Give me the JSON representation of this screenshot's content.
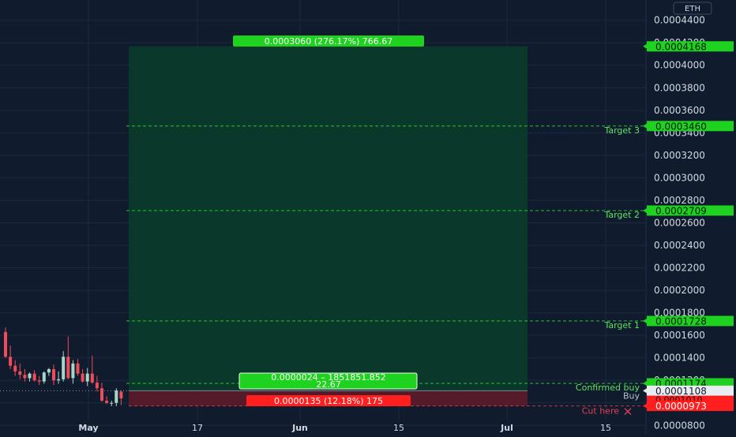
{
  "currency": "ETH",
  "colors": {
    "background": "#101b2e",
    "grid": "#1b2a40",
    "up": "#a5d6c8",
    "down": "#ef4b59",
    "profit_zone": "#0b3a2a",
    "loss_zone": "#5a1b2b",
    "level_line": "#2ed12e",
    "label_green": "#1fd21f",
    "label_red": "#ff1f1f",
    "axis_text": "#d4d9e2",
    "target_text": "#5fe35f",
    "cut_text": "#e3414f"
  },
  "chart_data": {
    "type": "candlestick",
    "x_ticks": [
      "May",
      "17",
      "Jun",
      "15",
      "Jul",
      "15"
    ],
    "y_ticks": [
      "0.0004400",
      "0.0004200",
      "0.0004000",
      "0.0003800",
      "0.0003600",
      "0.0003400",
      "0.0003200",
      "0.0003000",
      "0.0002800",
      "0.0002600",
      "0.0002400",
      "0.0002200",
      "0.0002000",
      "0.0001800",
      "0.0001600",
      "0.0001400",
      "0.0001200",
      "0.0001000",
      "0.0000800"
    ],
    "ylim": [
      7.25e-05,
      0.000458
    ],
    "candles": [
      {
        "o": 0.000163,
        "h": 0.000167,
        "l": 0.00014,
        "c": 0.000141
      },
      {
        "o": 0.000141,
        "h": 0.000151,
        "l": 0.00013,
        "c": 0.000133
      },
      {
        "o": 0.000133,
        "h": 0.000138,
        "l": 0.000124,
        "c": 0.000128
      },
      {
        "o": 0.000128,
        "h": 0.000135,
        "l": 0.000121,
        "c": 0.000125
      },
      {
        "o": 0.000125,
        "h": 0.00013,
        "l": 0.000119,
        "c": 0.000122
      },
      {
        "o": 0.000122,
        "h": 0.000127,
        "l": 0.000119,
        "c": 0.000126
      },
      {
        "o": 0.000126,
        "h": 0.000129,
        "l": 0.000119,
        "c": 0.00012
      },
      {
        "o": 0.00012,
        "h": 0.000124,
        "l": 0.000116,
        "c": 0.000119
      },
      {
        "o": 0.000119,
        "h": 0.000128,
        "l": 0.000117,
        "c": 0.000127
      },
      {
        "o": 0.000127,
        "h": 0.000131,
        "l": 0.000124,
        "c": 0.00013
      },
      {
        "o": 0.00013,
        "h": 0.000134,
        "l": 0.000116,
        "c": 0.00012
      },
      {
        "o": 0.00012,
        "h": 0.000128,
        "l": 0.000117,
        "c": 0.000121
      },
      {
        "o": 0.000121,
        "h": 0.000146,
        "l": 0.000119,
        "c": 0.000141
      },
      {
        "o": 0.000141,
        "h": 0.000159,
        "l": 0.000121,
        "c": 0.000122
      },
      {
        "o": 0.000122,
        "h": 0.000138,
        "l": 0.000117,
        "c": 0.000135
      },
      {
        "o": 0.000135,
        "h": 0.000139,
        "l": 0.000124,
        "c": 0.000126
      },
      {
        "o": 0.000126,
        "h": 0.00013,
        "l": 0.000118,
        "c": 0.000119
      },
      {
        "o": 0.000119,
        "h": 0.000131,
        "l": 0.000115,
        "c": 0.000126
      },
      {
        "o": 0.000126,
        "h": 0.000142,
        "l": 0.000117,
        "c": 0.000118
      },
      {
        "o": 0.000118,
        "h": 0.000124,
        "l": 0.00011,
        "c": 0.000113
      },
      {
        "o": 0.000113,
        "h": 0.000118,
        "l": 0.000101,
        "c": 0.000102
      },
      {
        "o": 0.000102,
        "h": 0.000106,
        "l": 9.9e-05,
        "c": 0.0001
      },
      {
        "o": 0.0001,
        "h": 0.000102,
        "l": 9.7e-05,
        "c": 0.0001
      },
      {
        "o": 0.0001,
        "h": 0.000113,
        "l": 9.7e-05,
        "c": 0.000111
      },
      {
        "o": 0.00011,
        "h": 0.000111,
        "l": 9.8e-05,
        "c": 0.000104
      }
    ],
    "levels": [
      {
        "name": "Target 3",
        "value": 0.000346,
        "price_label": "0.0003460"
      },
      {
        "name": "Target 2",
        "value": 0.0002709,
        "price_label": "0.0002709"
      },
      {
        "name": "Target 1",
        "value": 0.0001728,
        "price_label": "0.0001728"
      },
      {
        "name": "Confirmed buy",
        "value": 0.0001174,
        "price_label": "0.0001174"
      },
      {
        "name": "Cut here",
        "value": 9.73e-05,
        "price_label": "0.0000973"
      }
    ],
    "position": {
      "target_price": 0.0004168,
      "target_price_label": "0.0004168",
      "entry_price": 0.0001108,
      "entry_price_label": "0.0001108",
      "entry_name": "Buy",
      "stop_price": 9.73e-05,
      "stop_price_label": "0.0001010",
      "profit_label": "0.0003060 (276.17%) 766.67",
      "loss_label": "0.0000135 (12.18%) 175",
      "center_line1": "0.0000024 – 1851851.852",
      "center_line2": "22.67"
    }
  }
}
